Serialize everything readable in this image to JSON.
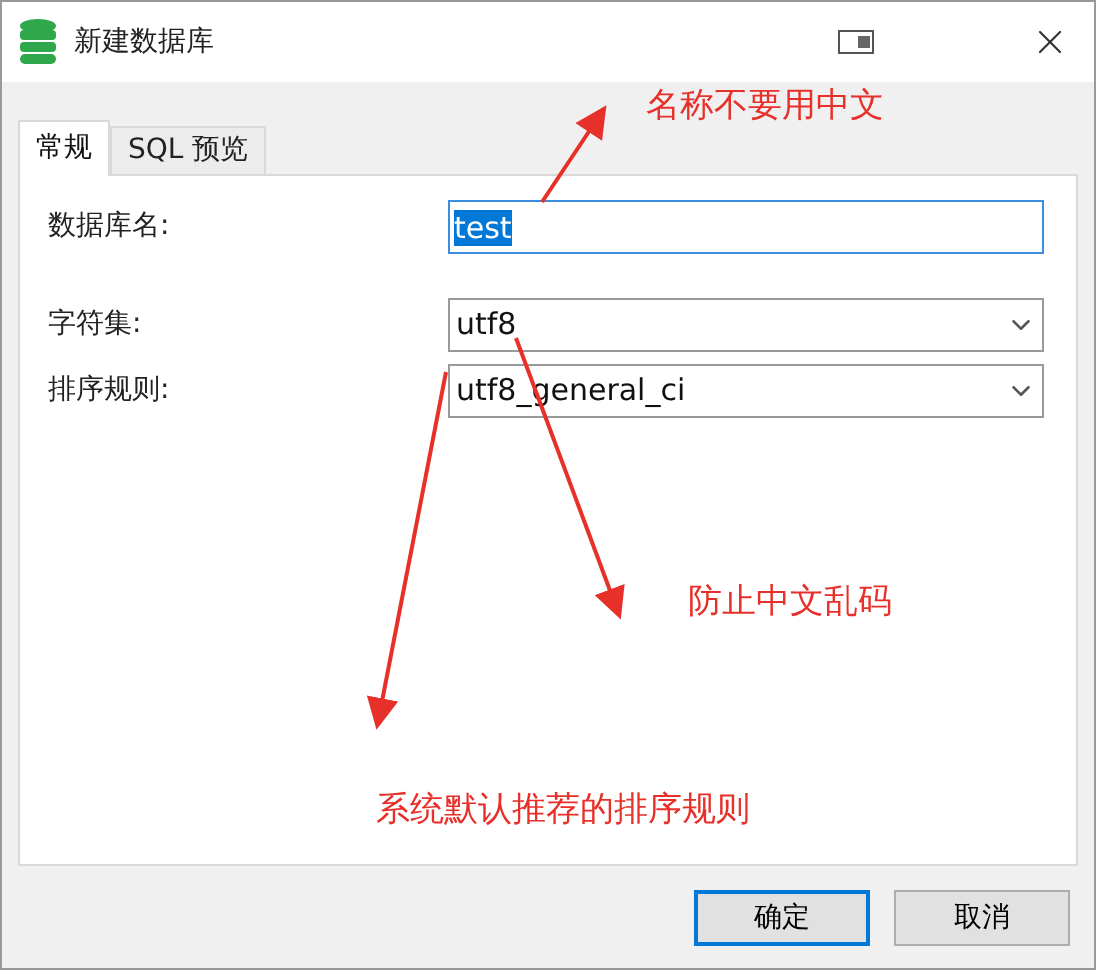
{
  "window": {
    "title": "新建数据库"
  },
  "tabs": [
    {
      "label": "常规",
      "selected": true
    },
    {
      "label": "SQL 预览",
      "selected": false
    }
  ],
  "fields": [
    {
      "kind": "text",
      "label": "数据库名:",
      "value": "test",
      "text_selected": true
    },
    {
      "kind": "dropdown",
      "label": "字符集:",
      "value": "utf8"
    },
    {
      "kind": "dropdown",
      "label": "排序规则:",
      "value": "utf8_general_ci"
    }
  ],
  "buttons": [
    {
      "label": "确定",
      "default": true
    },
    {
      "label": "取消",
      "default": false
    }
  ],
  "annotations": [
    {
      "text": "名称不要用中文"
    },
    {
      "text": "防止中文乱码"
    },
    {
      "text": "系统默认推荐的排序规则"
    }
  ]
}
